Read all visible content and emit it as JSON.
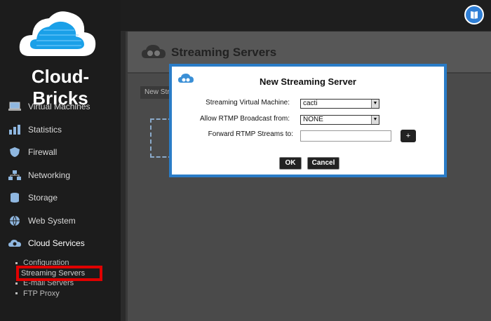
{
  "brand": {
    "name": "Cloud-Bricks"
  },
  "header": {
    "help_icon": "book-icon"
  },
  "sidebar": {
    "items": [
      {
        "label": "Virtual Machines",
        "icon": "laptop-icon"
      },
      {
        "label": "Statistics",
        "icon": "chart-icon"
      },
      {
        "label": "Firewall",
        "icon": "shield-icon"
      },
      {
        "label": "Networking",
        "icon": "network-icon"
      },
      {
        "label": "Storage",
        "icon": "database-icon"
      },
      {
        "label": "Web System",
        "icon": "globe-icon"
      },
      {
        "label": "Cloud Services",
        "icon": "cloud-gear-icon"
      }
    ],
    "subitems": [
      {
        "label": "Configuration"
      },
      {
        "label": "Streaming Servers"
      },
      {
        "label": "E-mail Servers"
      },
      {
        "label": "FTP Proxy"
      }
    ]
  },
  "main": {
    "title": "Streaming Servers",
    "new_button": "New Stre"
  },
  "dialog": {
    "title": "New Streaming Server",
    "vm_label": "Streaming Virtual Machine:",
    "vm_value": "cacti",
    "rtmp_label": "Allow RTMP Broadcast from:",
    "rtmp_value": "NONE",
    "forward_label": "Forward RTMP Streams to:",
    "forward_value": "",
    "add_label": "+",
    "ok_label": "OK",
    "cancel_label": "Cancel"
  },
  "colors": {
    "accent": "#2a7cc7",
    "highlight": "#e00000"
  }
}
